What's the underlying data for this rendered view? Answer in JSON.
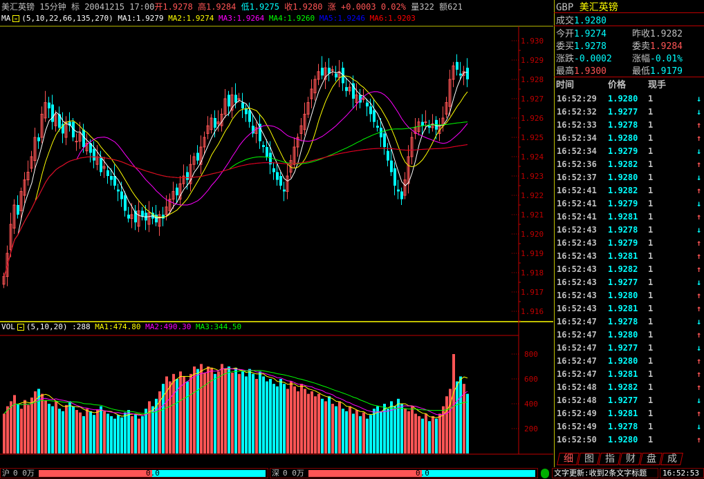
{
  "header": {
    "name": "美汇英镑",
    "period": "15分钟",
    "flag": "标",
    "date": "20041215",
    "time": "17:00",
    "open_label": "开",
    "open": "1.9278",
    "high_label": "高",
    "high": "1.9284",
    "low_label": "低",
    "low": "1.9275",
    "close_label": "收",
    "close": "1.9280",
    "change_label": "涨",
    "change": "+0.0003",
    "change_pct": "0.02%",
    "vol_label": "量",
    "vol": "322",
    "amt_label": "额",
    "amt": "621"
  },
  "ma_legend": {
    "label": "MA",
    "params": "(5,10,22,66,135,270)",
    "ma1": "MA1:1.9279",
    "ma2": "MA2:1.9274",
    "ma3": "MA3:1.9264",
    "ma4": "MA4:1.9260",
    "ma5": "MA5:1.9246",
    "ma6": "MA6:1.9203"
  },
  "vol_legend": {
    "label": "VOL",
    "params": "(5,10,20)",
    "value": ":288",
    "ma1": "MA1:474.80",
    "ma2": "MA2:490.30",
    "ma3": "MA3:344.50"
  },
  "colors": {
    "up": "#ff5555",
    "down": "#00ffff",
    "ma1": "#ffffff",
    "ma2": "#ffff00",
    "ma3": "#ff00ff",
    "ma4": "#00ff00",
    "ma5": "#0000ff",
    "ma6": "#ff0000",
    "axis": "#c00000"
  },
  "chart_data": {
    "type": "candlestick",
    "price_ylim": [
      1.9155,
      1.9305
    ],
    "price_ticks": [
      "1.930",
      "1.929",
      "1.928",
      "1.927",
      "1.926",
      "1.925",
      "1.924",
      "1.923",
      "1.922",
      "1.921",
      "1.920",
      "1.919",
      "1.918",
      "1.917",
      "1.916"
    ],
    "vol_ylim": [
      0,
      900
    ],
    "vol_ticks": [
      "800",
      "600",
      "400",
      "200"
    ],
    "ma_periods": [
      5,
      10,
      22,
      66,
      135,
      270
    ],
    "vol_ma_periods": [
      5,
      10,
      20
    ],
    "close": [
      1.9178,
      1.919,
      1.9205,
      1.9215,
      1.921,
      1.9222,
      1.9228,
      1.9232,
      1.924,
      1.925,
      1.9248,
      1.9262,
      1.9268,
      1.9265,
      1.9258,
      1.9262,
      1.9255,
      1.9252,
      1.9258,
      1.9256,
      1.925,
      1.9248,
      1.9252,
      1.9245,
      1.9247,
      1.9242,
      1.9238,
      1.924,
      1.9232,
      1.9235,
      1.923,
      1.9228,
      1.9225,
      1.9222,
      1.9218,
      1.9212,
      1.9208,
      1.921,
      1.9206,
      1.9212,
      1.9209,
      1.9207,
      1.9211,
      1.9208,
      1.9206,
      1.921,
      1.9208,
      1.9214,
      1.9218,
      1.9222,
      1.922,
      1.9226,
      1.923,
      1.9228,
      1.9236,
      1.924,
      1.9238,
      1.9245,
      1.925,
      1.9256,
      1.926,
      1.9255,
      1.9258,
      1.9262,
      1.927,
      1.9266,
      1.9272,
      1.9268,
      1.927,
      1.9265,
      1.9262,
      1.9258,
      1.9252,
      1.9255,
      1.9248,
      1.9245,
      1.924,
      1.9236,
      1.9232,
      1.9228,
      1.9225,
      1.9222,
      1.923,
      1.9238,
      1.9245,
      1.925,
      1.9256,
      1.9262,
      1.9268,
      1.9275,
      1.928,
      1.9284,
      1.9282,
      1.9286,
      1.9283,
      1.9285,
      1.9281,
      1.9284,
      1.9278,
      1.9274,
      1.9276,
      1.927,
      1.9272,
      1.9268,
      1.927,
      1.9266,
      1.9262,
      1.9258,
      1.9255,
      1.925,
      1.9245,
      1.9238,
      1.9232,
      1.9225,
      1.9222,
      1.9218,
      1.9228,
      1.924,
      1.925,
      1.9255,
      1.9258,
      1.9256,
      1.9258,
      1.9255,
      1.9257,
      1.9254,
      1.9256,
      1.926,
      1.9268,
      1.928,
      1.9287,
      1.9285,
      1.9282,
      1.9284,
      1.928
    ],
    "volume": [
      320,
      380,
      420,
      470,
      400,
      360,
      430,
      390,
      450,
      500,
      520,
      480,
      430,
      400,
      380,
      420,
      360,
      340,
      390,
      420,
      380,
      350,
      330,
      300,
      360,
      340,
      310,
      350,
      380,
      340,
      320,
      300,
      280,
      310,
      290,
      330,
      350,
      300,
      320,
      280,
      300,
      360,
      420,
      380,
      440,
      500,
      560,
      620,
      580,
      640,
      600,
      660,
      620,
      580,
      640,
      700,
      680,
      720,
      650,
      700,
      690,
      640,
      660,
      720,
      680,
      700,
      650,
      690,
      640,
      660,
      620,
      680,
      640,
      600,
      660,
      620,
      580,
      600,
      560,
      540,
      600,
      560,
      520,
      580,
      540,
      500,
      560,
      520,
      480,
      500,
      460,
      480,
      440,
      420,
      460,
      400,
      380,
      420,
      360,
      340,
      380,
      320,
      350,
      300,
      330,
      280,
      310,
      360,
      380,
      340,
      400,
      360,
      420,
      380,
      440,
      400,
      360,
      340,
      380,
      320,
      300,
      280,
      320,
      260,
      300,
      280,
      320,
      380,
      460,
      520,
      800,
      580,
      620,
      560,
      480
    ]
  },
  "quote": {
    "title_code": "GBP",
    "title_name": "美汇英镑",
    "deal_label": "成交",
    "deal": "1.9280",
    "open_label": "今开",
    "open": "1.9274",
    "prev_label": "昨收",
    "prev": "1.9282",
    "bid_label": "委买",
    "bid": "1.9278",
    "ask_label": "委卖",
    "ask": "1.9284",
    "chg_label": "涨跌",
    "chg": "-0.0002",
    "chgpct_label": "涨幅",
    "chgpct": "-0.01%",
    "high_label": "最高",
    "high": "1.9300",
    "low_label": "最低",
    "low": "1.9179"
  },
  "trades_header": {
    "time": "时间",
    "price": "价格",
    "qty": "现手"
  },
  "trades": [
    {
      "time": "16:52:29",
      "price": "1.9280",
      "qty": "1",
      "dir": "down"
    },
    {
      "time": "16:52:32",
      "price": "1.9277",
      "qty": "1",
      "dir": "down"
    },
    {
      "time": "16:52:33",
      "price": "1.9278",
      "qty": "1",
      "dir": "up"
    },
    {
      "time": "16:52:34",
      "price": "1.9280",
      "qty": "1",
      "dir": "up"
    },
    {
      "time": "16:52:34",
      "price": "1.9279",
      "qty": "1",
      "dir": "down"
    },
    {
      "time": "16:52:36",
      "price": "1.9282",
      "qty": "1",
      "dir": "up"
    },
    {
      "time": "16:52:37",
      "price": "1.9280",
      "qty": "1",
      "dir": "down"
    },
    {
      "time": "16:52:41",
      "price": "1.9282",
      "qty": "1",
      "dir": "up"
    },
    {
      "time": "16:52:41",
      "price": "1.9279",
      "qty": "1",
      "dir": "down"
    },
    {
      "time": "16:52:41",
      "price": "1.9281",
      "qty": "1",
      "dir": "up"
    },
    {
      "time": "16:52:43",
      "price": "1.9278",
      "qty": "1",
      "dir": "down"
    },
    {
      "time": "16:52:43",
      "price": "1.9279",
      "qty": "1",
      "dir": "up"
    },
    {
      "time": "16:52:43",
      "price": "1.9281",
      "qty": "1",
      "dir": "up"
    },
    {
      "time": "16:52:43",
      "price": "1.9282",
      "qty": "1",
      "dir": "up"
    },
    {
      "time": "16:52:43",
      "price": "1.9277",
      "qty": "1",
      "dir": "down"
    },
    {
      "time": "16:52:43",
      "price": "1.9280",
      "qty": "1",
      "dir": "up"
    },
    {
      "time": "16:52:43",
      "price": "1.9281",
      "qty": "1",
      "dir": "up"
    },
    {
      "time": "16:52:47",
      "price": "1.9278",
      "qty": "1",
      "dir": "down"
    },
    {
      "time": "16:52:47",
      "price": "1.9280",
      "qty": "1",
      "dir": "up"
    },
    {
      "time": "16:52:47",
      "price": "1.9277",
      "qty": "1",
      "dir": "down"
    },
    {
      "time": "16:52:47",
      "price": "1.9280",
      "qty": "1",
      "dir": "up"
    },
    {
      "time": "16:52:47",
      "price": "1.9281",
      "qty": "1",
      "dir": "up"
    },
    {
      "time": "16:52:48",
      "price": "1.9282",
      "qty": "1",
      "dir": "up"
    },
    {
      "time": "16:52:48",
      "price": "1.9277",
      "qty": "1",
      "dir": "down"
    },
    {
      "time": "16:52:49",
      "price": "1.9281",
      "qty": "1",
      "dir": "up"
    },
    {
      "time": "16:52:49",
      "price": "1.9278",
      "qty": "1",
      "dir": "down"
    },
    {
      "time": "16:52:50",
      "price": "1.9280",
      "qty": "1",
      "dir": "up"
    }
  ],
  "tabs": [
    "细",
    "图",
    "指",
    "财",
    "盘",
    "成"
  ],
  "status": {
    "sh_label": "沪",
    "sh_val": "0 0万",
    "sh_bar": "0.0",
    "sz_label": "深",
    "sz_val": "0 0万",
    "sz_bar": "0.0",
    "news": "文字更新:收到2条文字标题",
    "clock": "16:52:53"
  }
}
